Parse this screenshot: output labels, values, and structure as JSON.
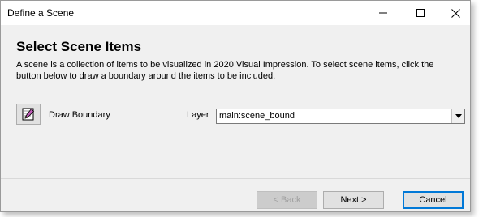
{
  "window": {
    "title": "Define a Scene"
  },
  "titlebar": {
    "minimize_icon": "minimize-icon",
    "maximize_icon": "maximize-icon",
    "close_icon": "close-icon"
  },
  "header": {
    "title": "Select Scene Items",
    "description": "A scene is a collection of items to be visualized in 2020 Visual Impression.  To select scene items, click the button below to draw a boundary around the items to be included."
  },
  "draw": {
    "icon": "pencil-icon",
    "label": "Draw Boundary"
  },
  "layer": {
    "label": "Layer",
    "value": "main:scene_bound"
  },
  "footer": {
    "back_label": "< Back",
    "next_label": "Next >",
    "cancel_label": "Cancel"
  },
  "colors": {
    "dialog_bg": "#f0f0f0",
    "focus_border": "#0078d7",
    "pencil_body": "#c05ab8"
  }
}
